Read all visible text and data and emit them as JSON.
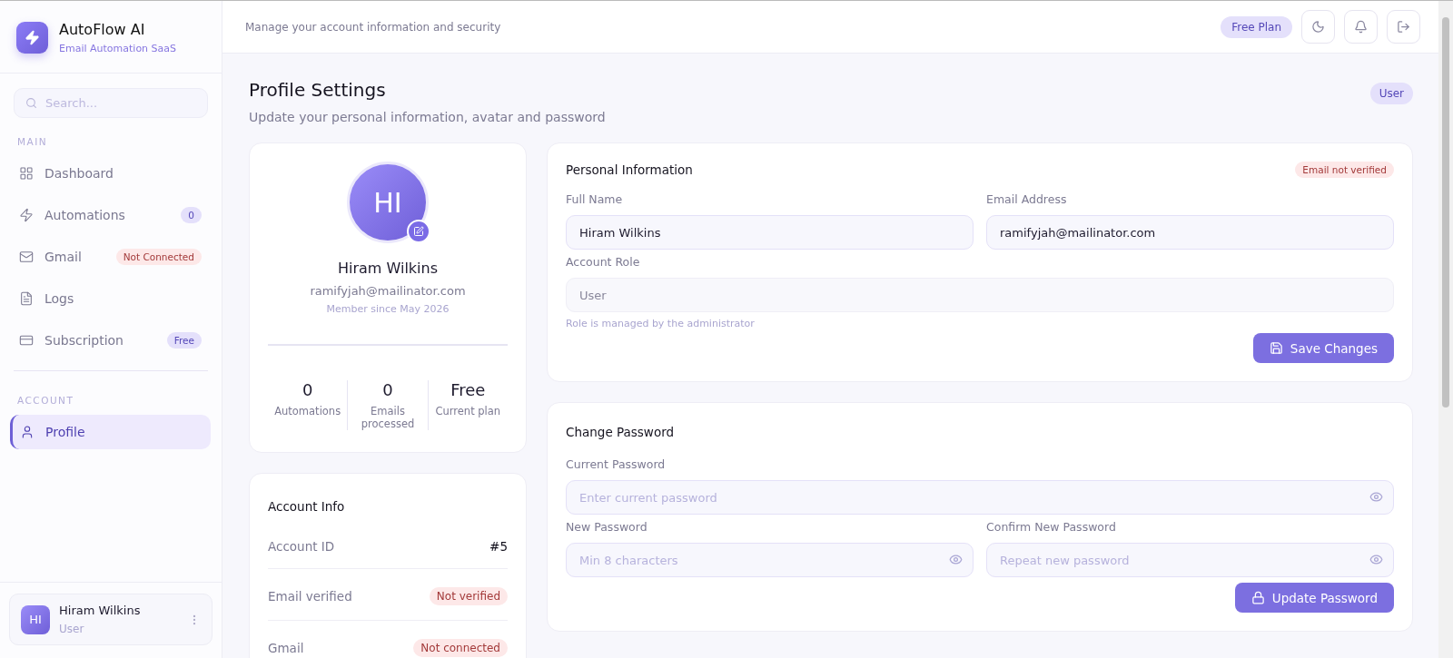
{
  "brand": {
    "name": "AutoFlow AI",
    "tagline": "Email Automation SaaS"
  },
  "search": {
    "placeholder": "Search..."
  },
  "nav_sections": [
    {
      "title": "MAIN",
      "items": [
        {
          "label": "Dashboard",
          "selected": false
        },
        {
          "label": "Automations",
          "selected": false,
          "badge": {
            "text": "0",
            "kind": "accent"
          }
        },
        {
          "label": "Gmail",
          "selected": false,
          "badge": {
            "text": "Not Connected",
            "kind": "danger"
          }
        },
        {
          "label": "Logs",
          "selected": false
        },
        {
          "label": "Subscription",
          "selected": false,
          "badge": {
            "text": "Free",
            "kind": "accent"
          }
        }
      ]
    },
    {
      "title": "ACCOUNT",
      "items": [
        {
          "label": "Profile",
          "selected": true
        }
      ]
    }
  ],
  "sidebar_user": {
    "initials": "HI",
    "name": "Hiram Wilkins",
    "role": "User"
  },
  "topbar": {
    "subtitle": "Manage your account information and security",
    "plan_badge": "Free Plan"
  },
  "page": {
    "title": "Profile Settings",
    "subtitle": "Update your personal information, avatar and password",
    "role_badge": "User"
  },
  "profile_card": {
    "initials": "HI",
    "name": "Hiram Wilkins",
    "email": "ramifyjah@mailinator.com",
    "member_since": "Member since May 2026",
    "stats": [
      {
        "value": "0",
        "label": "Automations"
      },
      {
        "value": "0",
        "label": "Emails processed"
      },
      {
        "value": "Free",
        "label": "Current plan"
      }
    ]
  },
  "account_info": {
    "title": "Account Info",
    "rows": [
      {
        "label": "Account ID",
        "value": "#5",
        "kind": "text"
      },
      {
        "label": "Email verified",
        "value": "Not verified",
        "kind": "danger"
      },
      {
        "label": "Gmail",
        "value": "Not connected",
        "kind": "danger"
      }
    ]
  },
  "personal_info": {
    "title": "Personal Information",
    "status_badge": "Email not verified",
    "rows": [
      [
        {
          "label": "Full Name",
          "value": "Hiram Wilkins",
          "kind": "text",
          "disabled": false
        },
        {
          "label": "Email Address",
          "value": "ramifyjah@mailinator.com",
          "kind": "text",
          "disabled": false
        }
      ],
      [
        {
          "label": "Account Role",
          "value": "User",
          "kind": "text",
          "disabled": true
        }
      ]
    ],
    "hint": "Role is managed by the administrator",
    "button": "Save Changes"
  },
  "change_password": {
    "title": "Change Password",
    "rows": [
      [
        {
          "label": "Current Password",
          "placeholder": "Enter current password",
          "kind": "password",
          "disabled": false
        }
      ],
      [
        {
          "label": "New Password",
          "placeholder": "Min 8 characters",
          "kind": "password",
          "disabled": false
        },
        {
          "label": "Confirm New Password",
          "placeholder": "Repeat new password",
          "kind": "password",
          "disabled": false
        }
      ]
    ],
    "button": "Update Password"
  }
}
